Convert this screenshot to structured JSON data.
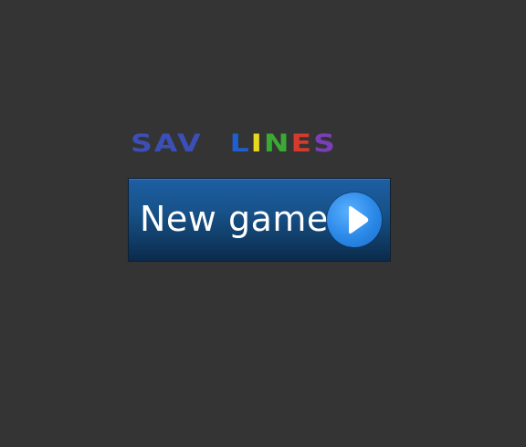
{
  "title": {
    "word1": "SAV",
    "word2_letters": [
      {
        "char": "L",
        "color": "#1f5fd0"
      },
      {
        "char": "I",
        "color": "#e6d81f"
      },
      {
        "char": "N",
        "color": "#3aaa35"
      },
      {
        "char": "E",
        "color": "#d63a2c"
      },
      {
        "char": "S",
        "color": "#7a3fb8"
      }
    ]
  },
  "new_game_button": {
    "label": "New game",
    "icon": "play-icon"
  }
}
